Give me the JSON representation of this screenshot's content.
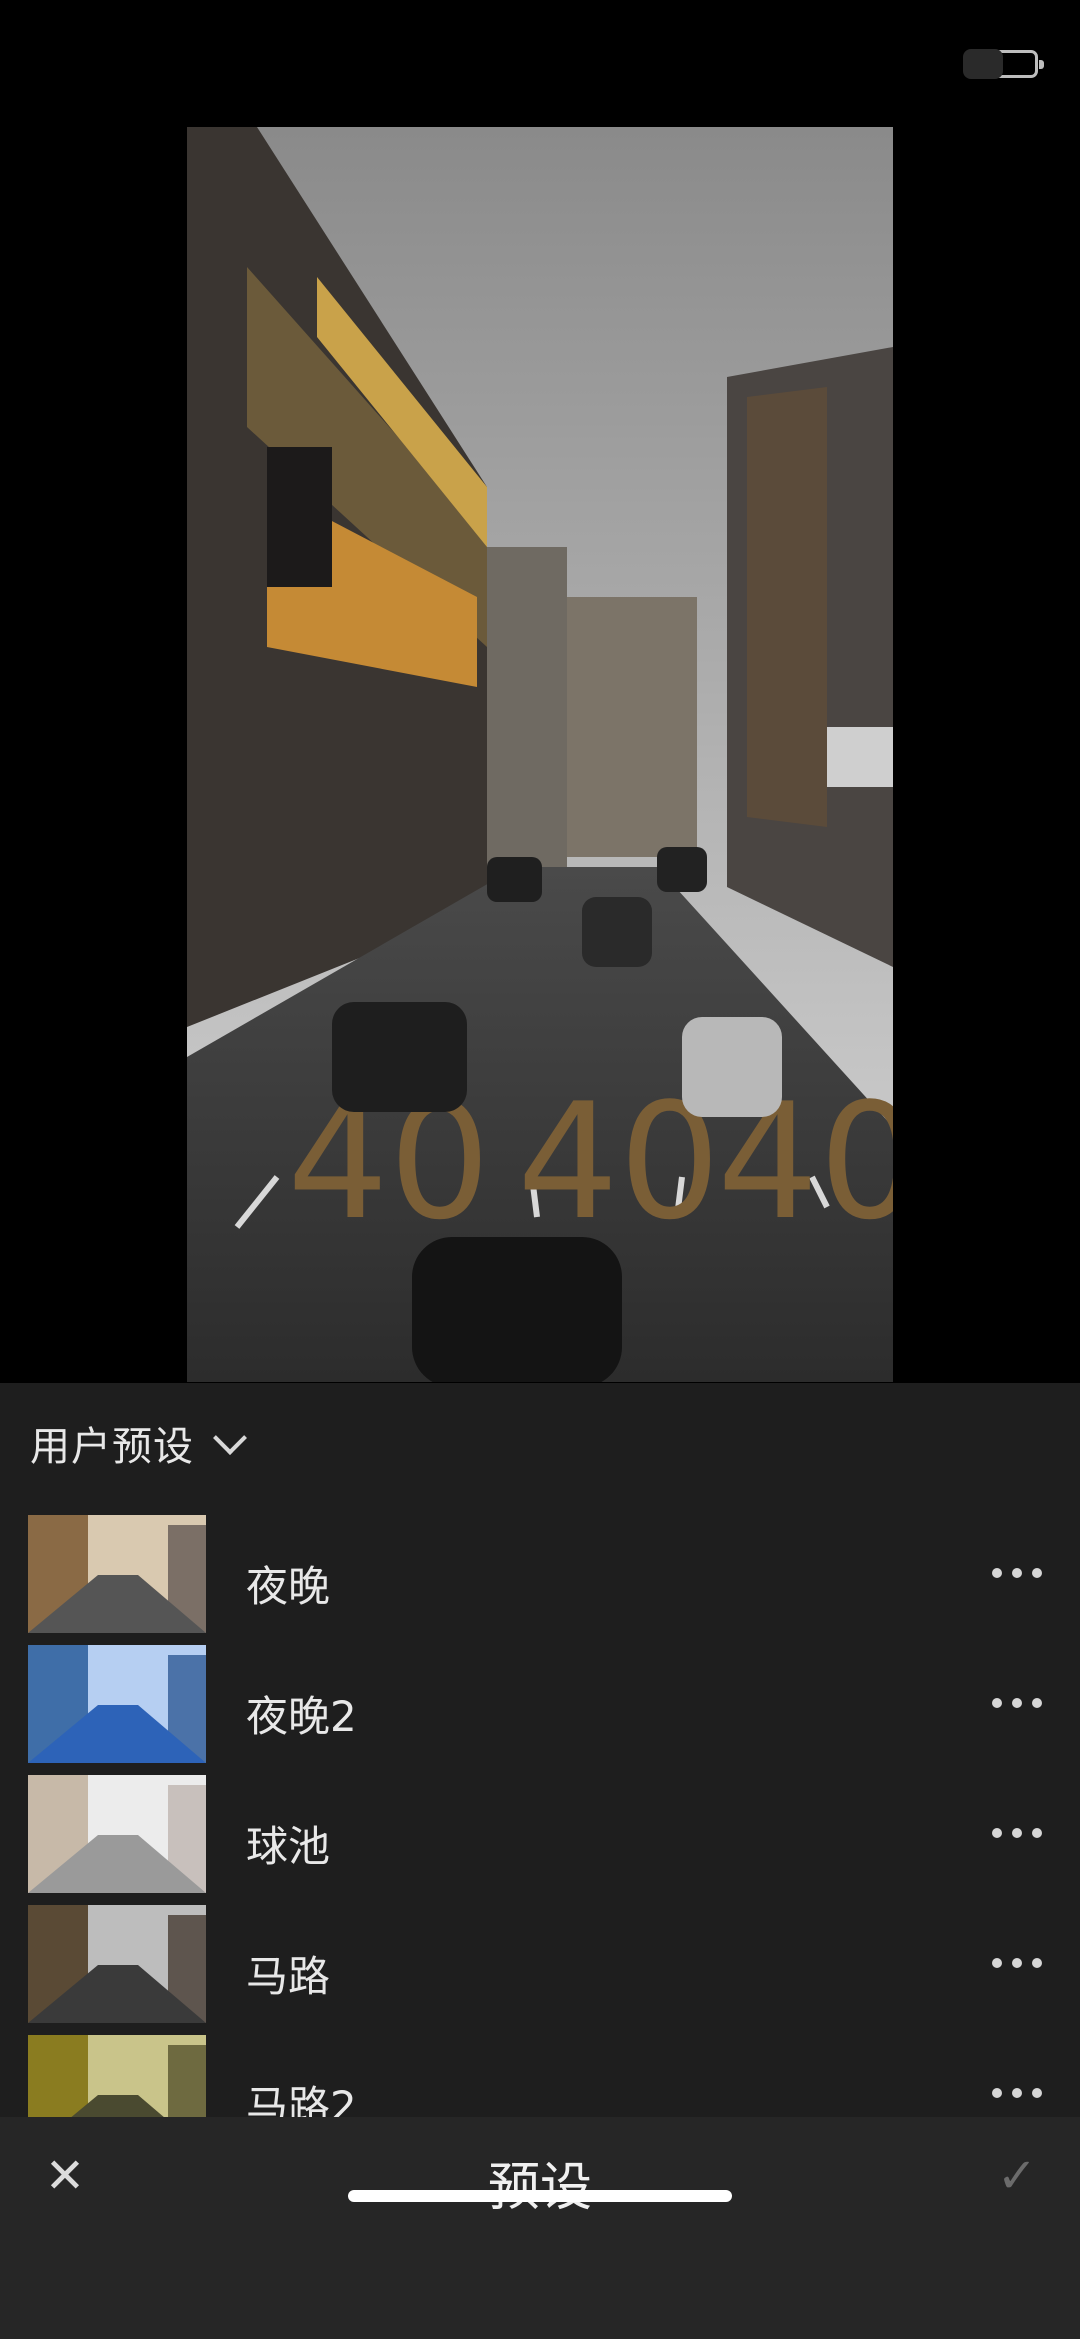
{
  "status": {
    "battery_icon": "battery-icon"
  },
  "photo": {
    "help_icon": "help-circle-icon",
    "more_icon": "more-horizontal-icon",
    "help_glyph": "?"
  },
  "presets": {
    "group_title": "用户预设",
    "items": [
      {
        "label": "夜晚",
        "tint": "#c8a070"
      },
      {
        "label": "夜晚2",
        "tint": "#3d7fd6"
      },
      {
        "label": "球池",
        "tint": "#d9d9d9"
      },
      {
        "label": "马路",
        "tint": "#9a8a70"
      },
      {
        "label": "马路2",
        "tint": "#a8a030"
      }
    ]
  },
  "toolbar": {
    "title": "预设",
    "close_glyph": "✕",
    "confirm_glyph": "✓"
  }
}
